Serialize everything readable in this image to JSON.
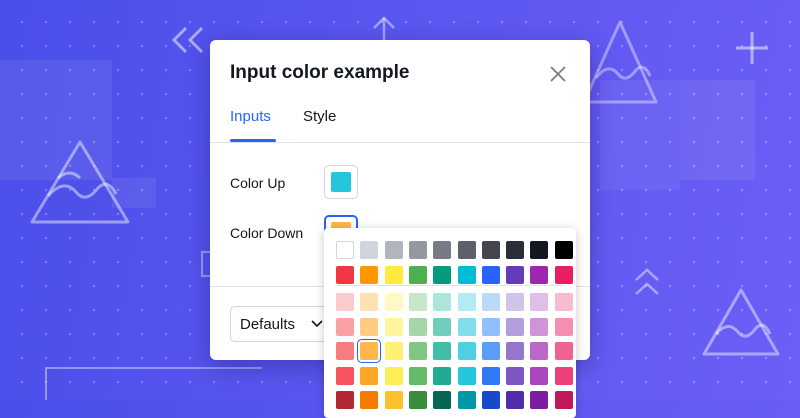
{
  "dialog": {
    "title": "Input color example",
    "tabs": [
      {
        "label": "Inputs",
        "active": true
      },
      {
        "label": "Style",
        "active": false
      }
    ],
    "rows": [
      {
        "label": "Color Up",
        "color": "#26c6da"
      },
      {
        "label": "Color Down",
        "color": "#ffb74d"
      }
    ],
    "footer": {
      "defaults_label": "Defaults"
    }
  },
  "palette": {
    "selected": "#ffb74d",
    "top_rows": [
      [
        "#ffffff",
        "#d1d4dc",
        "#b2b5be",
        "#9598a1",
        "#787b86",
        "#5d606b",
        "#434651",
        "#2a2e39",
        "#131722",
        "#000000"
      ],
      [
        "#f23645",
        "#ff9800",
        "#ffeb3b",
        "#4caf50",
        "#089981",
        "#00bcd4",
        "#2962ff",
        "#673ab7",
        "#9c27b0",
        "#e91e63"
      ]
    ],
    "bottom_rows": [
      [
        "#fccbcd",
        "#ffe0b2",
        "#fff9c4",
        "#c8e6c9",
        "#ace5dc",
        "#b2ebf2",
        "#bbd9fb",
        "#d1c4e9",
        "#e1bee7",
        "#f8bbd0"
      ],
      [
        "#faa1a4",
        "#ffcc80",
        "#fff59d",
        "#a5d6a7",
        "#70ccbd",
        "#80deea",
        "#90bff9",
        "#b39ddb",
        "#ce93d8",
        "#f48fb1"
      ],
      [
        "#f77c80",
        "#ffb74d",
        "#fff176",
        "#81c784",
        "#42bda8",
        "#4dd0e1",
        "#5b9cf6",
        "#9575cd",
        "#ba68c8",
        "#f06292"
      ],
      [
        "#f7525f",
        "#ffa726",
        "#ffee58",
        "#66bb6a",
        "#22ab94",
        "#26c6da",
        "#3179f5",
        "#7e57c2",
        "#ab47bc",
        "#ec407a"
      ],
      [
        "#b22833",
        "#f57c00",
        "#fbc02d",
        "#388e3c",
        "#056656",
        "#0097a7",
        "#1848cc",
        "#512da8",
        "#7b1fa2",
        "#c2185b"
      ]
    ]
  },
  "icons": {
    "close": "close-icon",
    "chevron": "chevron-down-icon"
  }
}
